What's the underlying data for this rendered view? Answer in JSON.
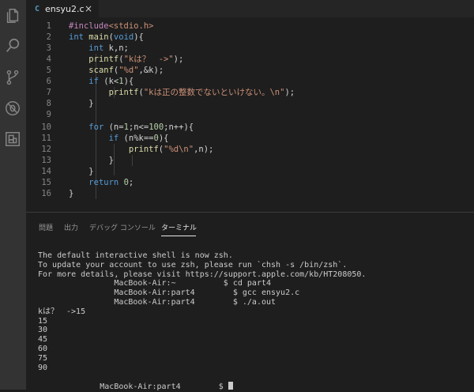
{
  "tab": {
    "lang_badge": "C",
    "filename": "ensyu2.c",
    "close": "×"
  },
  "code_lines": [
    "#include<stdio.h>",
    "int main(void){",
    "    int k,n;",
    "    printf(\"kは？　->\");",
    "    scanf(\"%d\",&k);",
    "    if (k<1){",
    "        printf(\"kは正の整数でないといけない。\\n\");",
    "    }",
    "",
    "    for (n=1;n<=100;n++){",
    "        if (n%k==0){",
    "            printf(\"%d\\n\",n);",
    "        }",
    "    }",
    "    return 0;",
    "}"
  ],
  "panel_tabs": [
    "問題",
    "出力",
    "デバッグ コンソール",
    "ターミナル"
  ],
  "terminal": {
    "lines": [
      "The default interactive shell is now zsh.",
      "To update your account to use zsh, please run `chsh -s /bin/zsh`.",
      "For more details, please visit https://support.apple.com/kb/HT208050.",
      "                MacBook-Air:~          $ cd part4",
      "                MacBook-Air:part4        $ gcc ensyu2.c",
      "                MacBook-Air:part4        $ ./a.out",
      "kは？　->15",
      "15",
      "30",
      "45",
      "60",
      "75",
      "90"
    ],
    "prompt": "             MacBook-Air:part4        $ "
  }
}
